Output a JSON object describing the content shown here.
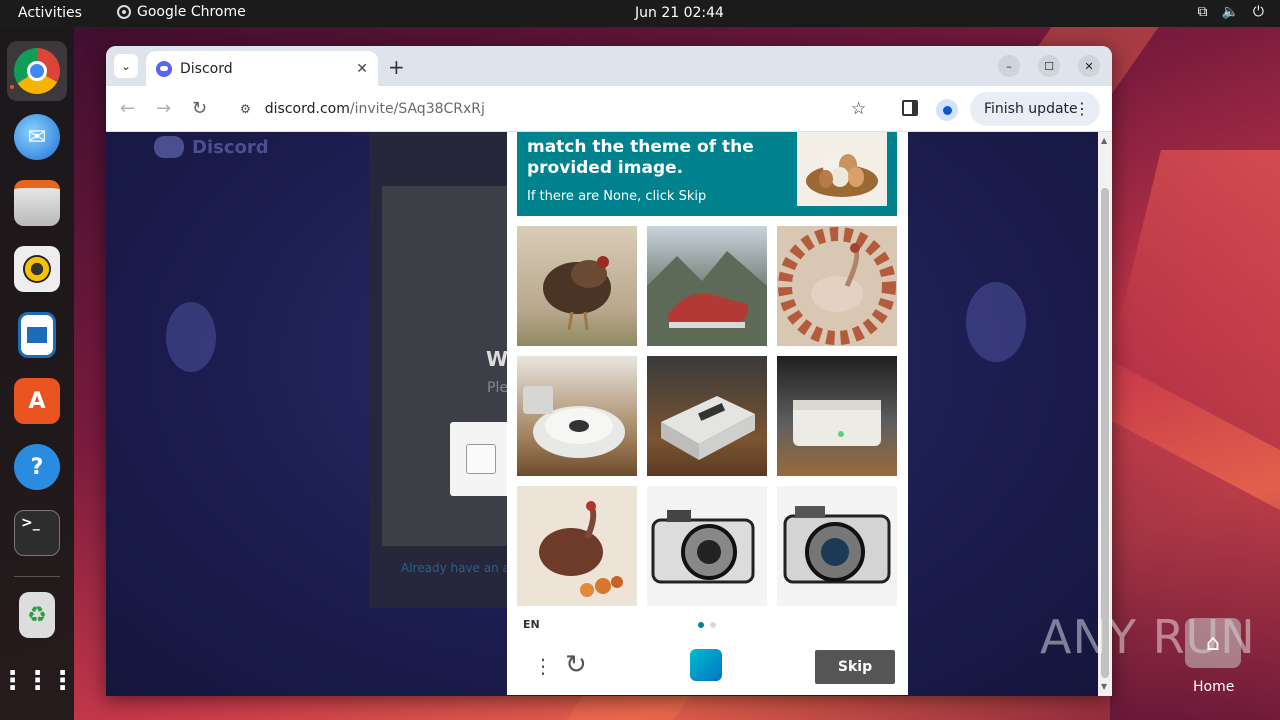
{
  "topbar": {
    "activities": "Activities",
    "app_name": "Google Chrome",
    "clock": "Jun 21  02:44"
  },
  "dock": {
    "items": [
      {
        "name": "chrome"
      },
      {
        "name": "thunderbird"
      },
      {
        "name": "files"
      },
      {
        "name": "rhythmbox"
      },
      {
        "name": "writer"
      },
      {
        "name": "app-center"
      },
      {
        "name": "help"
      },
      {
        "name": "terminal"
      },
      {
        "name": "trash"
      },
      {
        "name": "show-apps"
      }
    ]
  },
  "browser": {
    "tab_title": "Discord",
    "url_domain": "discord.com",
    "url_path": "/invite/SAq38CRxRj",
    "finish_update": "Finish update"
  },
  "discord": {
    "logo_text": "Discord",
    "heading_partial": "W",
    "sub_partial": "Ple",
    "already_partial": "Already have an a"
  },
  "captcha": {
    "question": "match the theme of the provided image.",
    "hint": "If there are None, click Skip",
    "language": "EN",
    "skip_label": "Skip",
    "accent": "#00838f",
    "cells": [
      {
        "name": "turkey"
      },
      {
        "name": "sneaker-mountains"
      },
      {
        "name": "turkey-flowers"
      },
      {
        "name": "robot-vacuum"
      },
      {
        "name": "device-box"
      },
      {
        "name": "device-white"
      },
      {
        "name": "turkey-autumn"
      },
      {
        "name": "camera-sketch"
      },
      {
        "name": "camera-sketch-2"
      }
    ]
  },
  "desktop": {
    "watermark": "ANY RUN",
    "home_label": "Home"
  }
}
